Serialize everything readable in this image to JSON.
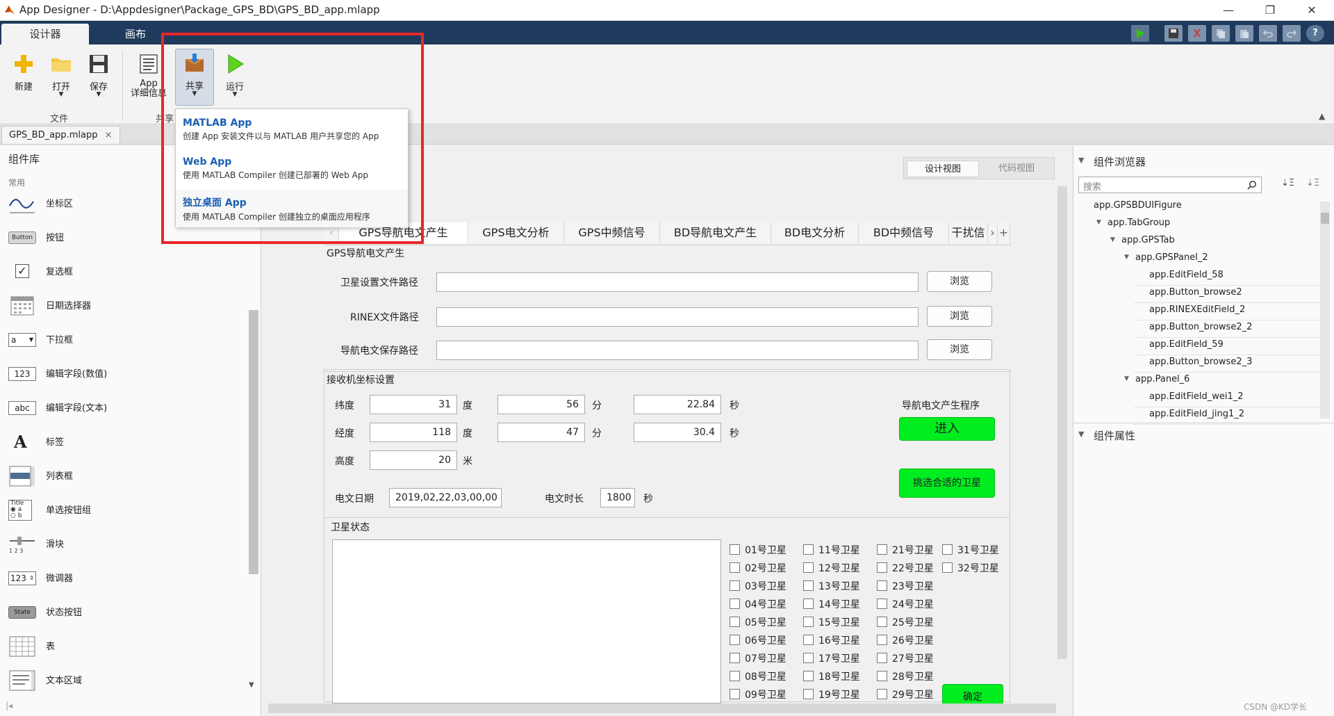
{
  "window": {
    "title": "App Designer - D:\\Appdesigner\\Package_GPS_BD\\GPS_BD_app.mlapp",
    "minimize": "—",
    "restore": "❐",
    "close": "✕"
  },
  "ribbon": {
    "tabs": [
      "设计器",
      "画布"
    ],
    "buttons": {
      "new": "新建",
      "open": "打开",
      "save": "保存",
      "app_details_1": "App",
      "app_details_2": "详细信息",
      "share": "共享",
      "run": "运行"
    },
    "groups": {
      "file": "文件",
      "share": "共享"
    },
    "quick_access_icons": [
      "run-icon",
      "save-icon",
      "cut-icon",
      "copy-icon",
      "paste-icon",
      "undo-icon",
      "redo-icon",
      "help-icon"
    ],
    "help": "?"
  },
  "file_tab": {
    "name": "GPS_BD_app.mlapp",
    "close": "×"
  },
  "share_menu": [
    {
      "title": "MATLAB App",
      "desc": "创建 App 安装文件以与 MATLAB 用户共享您的 App"
    },
    {
      "title": "Web App",
      "desc": "使用 MATLAB Compiler 创建已部署的 Web App"
    },
    {
      "title": "独立桌面 App",
      "desc": "使用 MATLAB Compiler 创建独立的桌面应用程序"
    }
  ],
  "component_library": {
    "title": "组件库",
    "section": "常用",
    "items": [
      {
        "label": "坐标区",
        "icon": "axes-icon"
      },
      {
        "label": "按钮",
        "icon": "button-icon",
        "icon_text": "Button"
      },
      {
        "label": "复选框",
        "icon": "checkbox-icon"
      },
      {
        "label": "日期选择器",
        "icon": "calendar-icon"
      },
      {
        "label": "下拉框",
        "icon": "dropdown-icon",
        "icon_text": "a"
      },
      {
        "label": "编辑字段(数值)",
        "icon": "numeric-field-icon",
        "icon_text": "123"
      },
      {
        "label": "编辑字段(文本)",
        "icon": "text-field-icon",
        "icon_text": "abc"
      },
      {
        "label": "标签",
        "icon": "label-icon",
        "icon_text": "A"
      },
      {
        "label": "列表框",
        "icon": "listbox-icon"
      },
      {
        "label": "单选按钮组",
        "icon": "radio-group-icon",
        "icon_text": "Title"
      },
      {
        "label": "滑块",
        "icon": "slider-icon"
      },
      {
        "label": "微调器",
        "icon": "spinner-icon",
        "icon_text": "123"
      },
      {
        "label": "状态按钮",
        "icon": "state-button-icon",
        "icon_text": "State"
      },
      {
        "label": "表",
        "icon": "table-icon"
      },
      {
        "label": "文本区域",
        "icon": "textarea-icon"
      }
    ]
  },
  "view_toggle": {
    "design": "设计视图",
    "code": "代码视图"
  },
  "app": {
    "tabs": [
      "GPS导航电文产生",
      "GPS电文分析",
      "GPS中频信号",
      "BD导航电文产生",
      "BD电文分析",
      "BD中频信号",
      "干扰信"
    ],
    "tab_more": "›",
    "tab_add": "+",
    "tab_prev": "‹",
    "panel1": {
      "title": "GPS导航电文产生",
      "rows": [
        {
          "label": "卫星设置文件路径",
          "value": "",
          "button": "浏览"
        },
        {
          "label": "RINEX文件路径",
          "value": "",
          "button": "浏览"
        },
        {
          "label": "导航电文保存路径",
          "value": "",
          "button": "浏览"
        }
      ]
    },
    "panel2": {
      "title": "接收机坐标设置",
      "lat_label": "纬度",
      "lat_deg": "31",
      "lat_min": "56",
      "lat_sec": "22.84",
      "lon_label": "经度",
      "lon_deg": "118",
      "lon_min": "47",
      "lon_sec": "30.4",
      "alt_label": "高度",
      "alt_value": "20",
      "alt_unit": "米",
      "deg_unit": "度",
      "min_unit": "分",
      "sec_unit": "秒",
      "program_label": "导航电文产生程序",
      "enter_button": "进入",
      "select_button": "挑选合适的卫星",
      "date_label": "电文日期",
      "date_value": "2019,02,22,03,00,00",
      "duration_label": "电文时长",
      "duration_value": "1800",
      "duration_unit": "秒"
    },
    "panel3": {
      "title": "卫星状态",
      "satellites": [
        "01号卫星",
        "02号卫星",
        "03号卫星",
        "04号卫星",
        "05号卫星",
        "06号卫星",
        "07号卫星",
        "08号卫星",
        "09号卫星",
        "11号卫星",
        "12号卫星",
        "13号卫星",
        "14号卫星",
        "15号卫星",
        "16号卫星",
        "17号卫星",
        "18号卫星",
        "19号卫星",
        "21号卫星",
        "22号卫星",
        "23号卫星",
        "24号卫星",
        "25号卫星",
        "26号卫星",
        "27号卫星",
        "28号卫星",
        "29号卫星",
        "31号卫星",
        "32号卫星"
      ],
      "confirm_button": "确定"
    }
  },
  "component_browser": {
    "title": "组件浏览器",
    "search_placeholder": "搜索",
    "tree": [
      {
        "label": "app.GPSBDUIFigure",
        "level": 0
      },
      {
        "label": "app.TabGroup",
        "level": 1
      },
      {
        "label": "app.GPSTab",
        "level": 2
      },
      {
        "label": "app.GPSPanel_2",
        "level": 3
      },
      {
        "label": "app.EditField_58",
        "level": 4
      },
      {
        "label": "app.Button_browse2",
        "level": 4
      },
      {
        "label": "app.RINEXEditField_2",
        "level": 4
      },
      {
        "label": "app.Button_browse2_2",
        "level": 4
      },
      {
        "label": "app.EditField_59",
        "level": 4
      },
      {
        "label": "app.Button_browse2_3",
        "level": 4
      },
      {
        "label": "app.Panel_6",
        "level": 3
      },
      {
        "label": "app.EditField_wei1_2",
        "level": 4
      },
      {
        "label": "app.EditField_jing1_2",
        "level": 4
      }
    ],
    "properties_title": "组件属性"
  },
  "watermark": "CSDN @KD学长"
}
